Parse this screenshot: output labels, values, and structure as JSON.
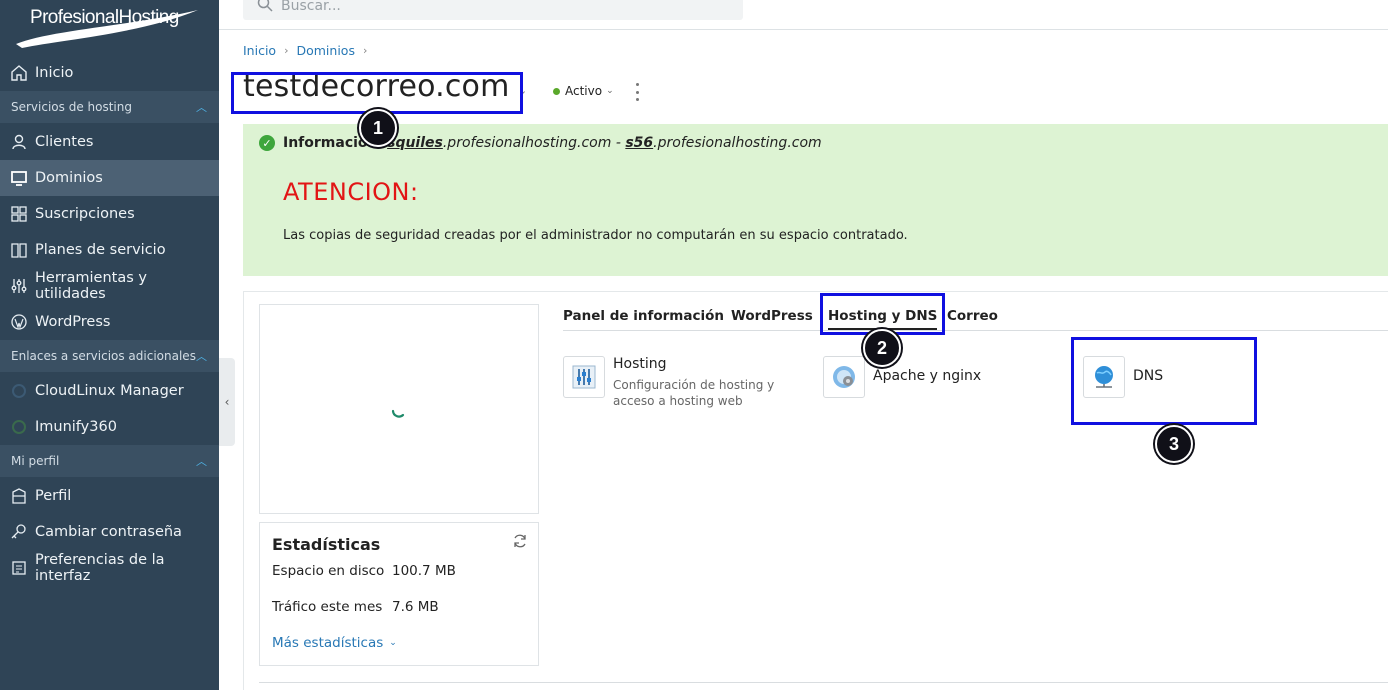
{
  "app": {
    "logo_text": "ProfesionalHosting"
  },
  "search": {
    "placeholder": "Buscar..."
  },
  "sidebar": {
    "home": "Inicio",
    "section_hosting": "Servicios de hosting",
    "items_hosting": [
      "Clientes",
      "Dominios",
      "Suscripciones",
      "Planes de servicio",
      "Herramientas y utilidades",
      "WordPress"
    ],
    "active_item": "Dominios",
    "section_links": "Enlaces a servicios adicionales",
    "items_links": [
      "CloudLinux Manager",
      "Imunify360"
    ],
    "section_profile": "Mi perfil",
    "items_profile": [
      "Perfil",
      "Cambiar contraseña",
      "Preferencias de la interfaz"
    ]
  },
  "breadcrumb": [
    "Inicio",
    "Dominios"
  ],
  "domain": {
    "name": "testdecorreo.com",
    "status": "Activo"
  },
  "info": {
    "label": "Información:",
    "server1": "squiles",
    "domain_suffix": ".profesionalhosting.com",
    "separator": " - ",
    "server2": "s56",
    "attention": "ATENCION:",
    "note": "Las copias de seguridad creadas por el administrador no computarán en su espacio contratado."
  },
  "stats": {
    "title": "Estadísticas",
    "disk_label": "Espacio en disco",
    "disk_value": "100.7 MB",
    "traffic_label": "Tráfico este mes",
    "traffic_value": "7.6 MB",
    "more_link": "Más estadísticas"
  },
  "tabs": [
    "Panel de información",
    "WordPress",
    "Hosting y DNS",
    "Correo"
  ],
  "active_tab": "Hosting y DNS",
  "tools": [
    {
      "name": "Hosting",
      "description": "Configuración de hosting y acceso a hosting web"
    },
    {
      "name": "Apache y nginx",
      "description": ""
    },
    {
      "name": "DNS",
      "description": ""
    }
  ],
  "annotations": [
    "1",
    "2",
    "3"
  ],
  "colors": {
    "sidebar_bg": "#2f4456",
    "info_bg": "#ddf3d3",
    "attention": "#e21515",
    "link": "#2878b5",
    "highlight": "#1010e0",
    "status_dot": "#5aa82a"
  }
}
